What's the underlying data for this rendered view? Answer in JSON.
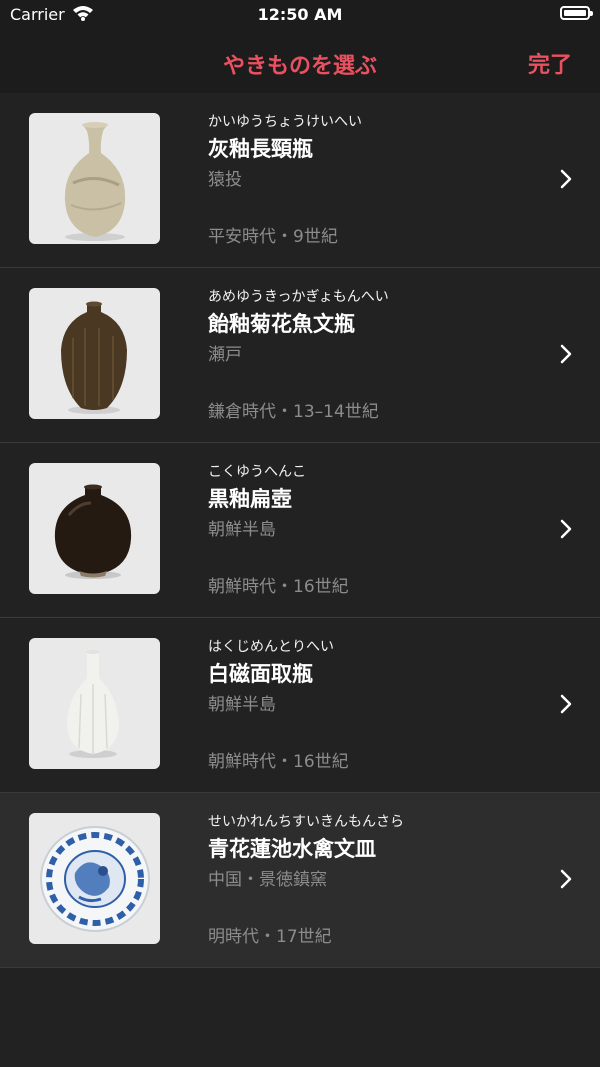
{
  "status_bar": {
    "carrier": "Carrier",
    "time": "12:50 AM"
  },
  "nav": {
    "title": "やきものを選ぶ",
    "done_label": "完了",
    "accent_color": "#ea5160"
  },
  "items": [
    {
      "reading": "かいゆうちょうけいへい",
      "name": "灰釉長頸瓶",
      "origin": "猿投",
      "period": "平安時代・9世紀",
      "icon": "celadon-vase-thumbnail"
    },
    {
      "reading": "あめゆうきっかぎょもんへい",
      "name": "飴釉菊花魚文瓶",
      "origin": "瀬戸",
      "period": "鎌倉時代・13–14世紀",
      "icon": "amber-glaze-vase-thumbnail"
    },
    {
      "reading": "こくゆうへんこ",
      "name": "黒釉扁壺",
      "origin": "朝鮮半島",
      "period": "朝鮮時代・16世紀",
      "icon": "black-glaze-flask-thumbnail"
    },
    {
      "reading": "はくじめんとりへい",
      "name": "白磁面取瓶",
      "origin": "朝鮮半島",
      "period": "朝鮮時代・16世紀",
      "icon": "white-porcelain-bottle-thumbnail"
    },
    {
      "reading": "せいかれんちすいきんもんさら",
      "name": "青花蓮池水禽文皿",
      "origin": "中国・景徳鎮窯",
      "period": "明時代・17世紀",
      "icon": "blue-white-dish-thumbnail",
      "selected": true
    }
  ]
}
